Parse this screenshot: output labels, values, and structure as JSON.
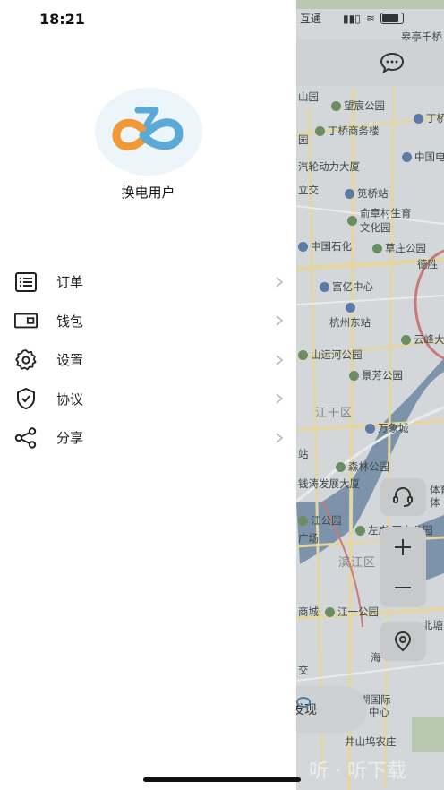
{
  "status": {
    "time": "18:21",
    "carrier_fragment": "互通"
  },
  "user": {
    "name": "换电用户"
  },
  "menu": [
    {
      "label": "订单",
      "icon": "list-icon"
    },
    {
      "label": "钱包",
      "icon": "wallet-icon"
    },
    {
      "label": "设置",
      "icon": "gear-icon"
    },
    {
      "label": "协议",
      "icon": "shield-check-icon"
    },
    {
      "label": "分享",
      "icon": "share-icon"
    }
  ],
  "map": {
    "pois": [
      "皋亭千桥",
      "山园",
      "望宸公园",
      "丁桥",
      "丁桥商务楼",
      "园",
      "中国电",
      "汽轮动力大厦",
      "笕桥站",
      "立交",
      "俞章村生育文化园",
      "中国石化",
      "草庄公园",
      "德胜",
      "富亿中心",
      "杭州东站",
      "云峰大",
      "山运河公园",
      "景芳公园",
      "江干区",
      "万象城",
      "站",
      "森林公园",
      "钱涛发展大厦",
      "滨江区",
      "左岸·万向公园",
      "江公园",
      "广场",
      "商城",
      "江一公园",
      "北塘",
      "海",
      "交",
      "湖国际",
      "中心",
      "井山坞农庄",
      "体育",
      "体"
    ],
    "find_label": "发现",
    "watermark": "听 · 听下载",
    "colors": {
      "park": "#6b8d62",
      "water": "#7c93ab",
      "road_major": "#e3d6a3",
      "road_red": "#c97a78"
    }
  },
  "icons": {
    "chat": "chat-bubble-icon",
    "service": "headset-icon",
    "zoom_in": "plus-icon",
    "zoom_out": "minus-icon",
    "locate": "location-pin-icon",
    "find": "eye-icon"
  }
}
